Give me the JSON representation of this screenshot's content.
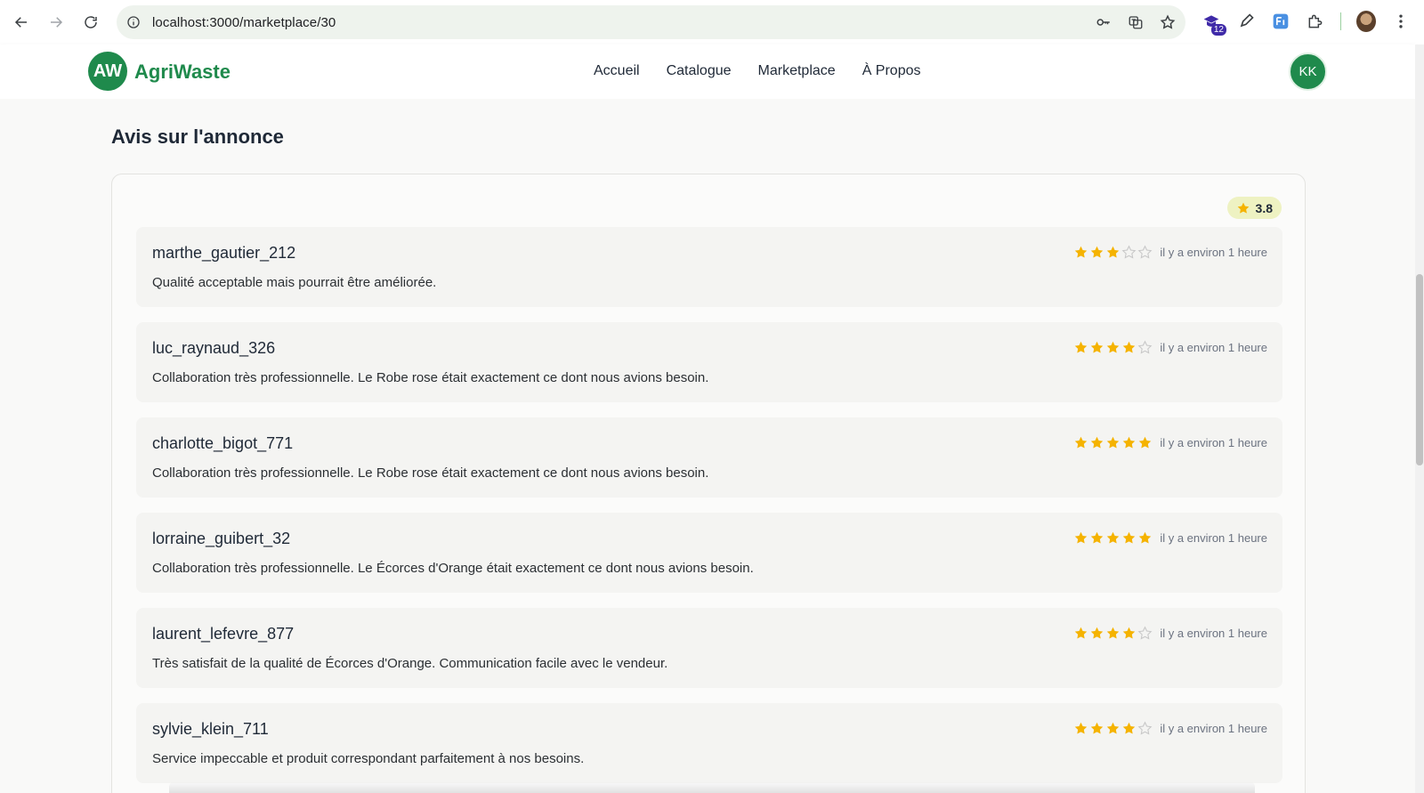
{
  "browser": {
    "url": "localhost:3000/marketplace/30",
    "extension_badge": "12"
  },
  "header": {
    "logo_initials": "AW",
    "brand": "AgriWaste",
    "nav": [
      "Accueil",
      "Catalogue",
      "Marketplace",
      "À Propos"
    ],
    "user_initials": "KK"
  },
  "reviews_section": {
    "title": "Avis sur l'annonce",
    "average_rating": "3.8",
    "star_color": "#f5b301",
    "items": [
      {
        "user": "marthe_gautier_212",
        "rating": 3,
        "time": "il y a environ 1 heure",
        "comment": "Qualité acceptable mais pourrait être améliorée."
      },
      {
        "user": "luc_raynaud_326",
        "rating": 4,
        "time": "il y a environ 1 heure",
        "comment": "Collaboration très professionnelle. Le Robe rose était exactement ce dont nous avions besoin."
      },
      {
        "user": "charlotte_bigot_771",
        "rating": 5,
        "time": "il y a environ 1 heure",
        "comment": "Collaboration très professionnelle. Le Robe rose était exactement ce dont nous avions besoin."
      },
      {
        "user": "lorraine_guibert_32",
        "rating": 5,
        "time": "il y a environ 1 heure",
        "comment": "Collaboration très professionnelle. Le Écorces d'Orange était exactement ce dont nous avions besoin."
      },
      {
        "user": "laurent_lefevre_877",
        "rating": 4,
        "time": "il y a environ 1 heure",
        "comment": "Très satisfait de la qualité de Écorces d'Orange. Communication facile avec le vendeur."
      },
      {
        "user": "sylvie_klein_711",
        "rating": 4,
        "time": "il y a environ 1 heure",
        "comment": "Service impeccable et produit correspondant parfaitement à nos besoins."
      }
    ]
  }
}
